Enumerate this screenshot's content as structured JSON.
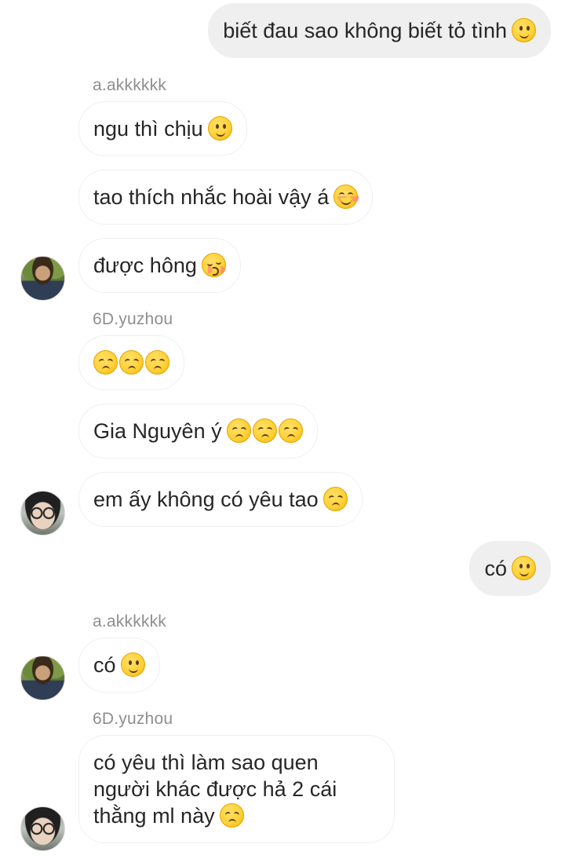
{
  "messages": [
    {
      "id": "m1",
      "side": "out",
      "text": "biết đau sao không biết tỏ tình",
      "emojis": [
        "smile"
      ]
    },
    {
      "id": "sender1",
      "type": "sender",
      "text": "a.akkkkkk"
    },
    {
      "id": "m2",
      "side": "in",
      "text": "ngu thì chịu",
      "emojis": [
        "smile"
      ]
    },
    {
      "id": "m3",
      "side": "in",
      "text": "tao thích nhắc hoài vậy á",
      "emojis": [
        "blush"
      ]
    },
    {
      "id": "m4",
      "side": "in",
      "text": "được hông",
      "emojis": [
        "kiss"
      ],
      "avatar": "a.akkkkkk"
    },
    {
      "id": "sender2",
      "type": "sender",
      "text": "6D.yuzhou"
    },
    {
      "id": "m5",
      "side": "in",
      "text": "",
      "emojis": [
        "sad",
        "sad",
        "sad"
      ]
    },
    {
      "id": "m6",
      "side": "in",
      "text": "Gia Nguyên ý",
      "emojis": [
        "sad",
        "sad",
        "sad"
      ]
    },
    {
      "id": "m7",
      "side": "in",
      "text": "em ấy không có yêu tao",
      "emojis": [
        "sad"
      ],
      "avatar": "6D.yuzhou"
    },
    {
      "id": "m8",
      "side": "out",
      "text": "có",
      "emojis": [
        "smile"
      ]
    },
    {
      "id": "sender3",
      "type": "sender",
      "text": "a.akkkkkk"
    },
    {
      "id": "m9",
      "side": "in",
      "text": "có",
      "emojis": [
        "smile"
      ],
      "avatar": "a.akkkkkk"
    },
    {
      "id": "sender4",
      "type": "sender",
      "text": "6D.yuzhou"
    },
    {
      "id": "m10",
      "side": "in",
      "text": "có yêu thì làm sao quen người khác được hả 2 cái thằng ml này",
      "emojis": [
        "sad"
      ],
      "avatar": "6D.yuzhou"
    }
  ],
  "text": {
    "m1": "biết đau sao không biết tỏ tình",
    "s1": "a.akkkkkk",
    "m2": "ngu thì chịu",
    "m3": "tao thích nhắc hoài vậy á",
    "m4": "được hông",
    "s2": "6D.yuzhou",
    "m6": "Gia Nguyên ý",
    "m7": "em ấy không có yêu tao",
    "m8": "có",
    "s3": "a.akkkkkk",
    "m9": "có",
    "s4": "6D.yuzhou",
    "m10": "có yêu thì làm sao quen người khác được hả 2 cái thằng ml này"
  },
  "colors": {
    "outgoing_bubble": "#efefef",
    "incoming_border": "#efefef",
    "sender_name": "#8e8e8e",
    "text": "#262626"
  }
}
